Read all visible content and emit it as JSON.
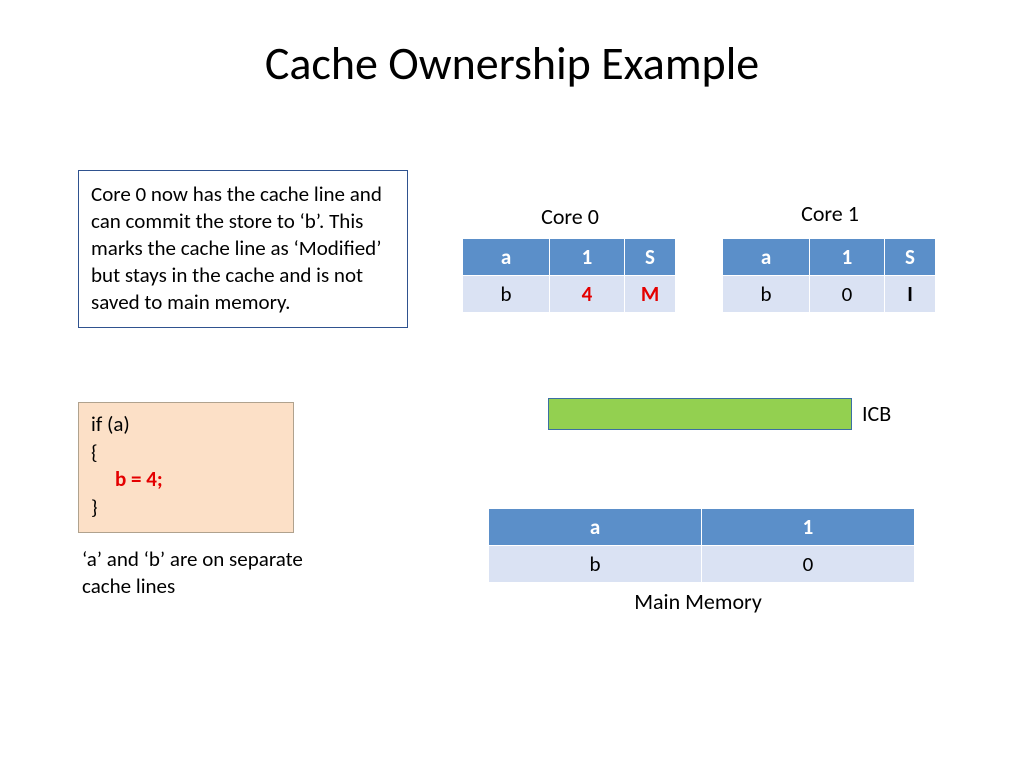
{
  "title": "Cache Ownership Example",
  "description": "Core 0 now has the cache line and can commit the store to ‘b’. This marks the cache line as ‘Modified’ but stays in the cache and is not saved to main memory.",
  "code": {
    "l1": "if (a)",
    "l2": "{",
    "l3": "b = 4;",
    "l4": "}"
  },
  "footnote": "‘a’ and ‘b’ are on separate cache lines",
  "core0": {
    "label": "Core 0",
    "r1": {
      "var": "a",
      "val": "1",
      "state": "S"
    },
    "r2": {
      "var": "b",
      "val": "4",
      "state": "M"
    }
  },
  "core1": {
    "label": "Core 1",
    "r1": {
      "var": "a",
      "val": "1",
      "state": "S"
    },
    "r2": {
      "var": "b",
      "val": "0",
      "state": "I"
    }
  },
  "icb": {
    "label": "ICB"
  },
  "memory": {
    "label": "Main Memory",
    "r1": {
      "var": "a",
      "val": "1"
    },
    "r2": {
      "var": "b",
      "val": "0"
    }
  }
}
